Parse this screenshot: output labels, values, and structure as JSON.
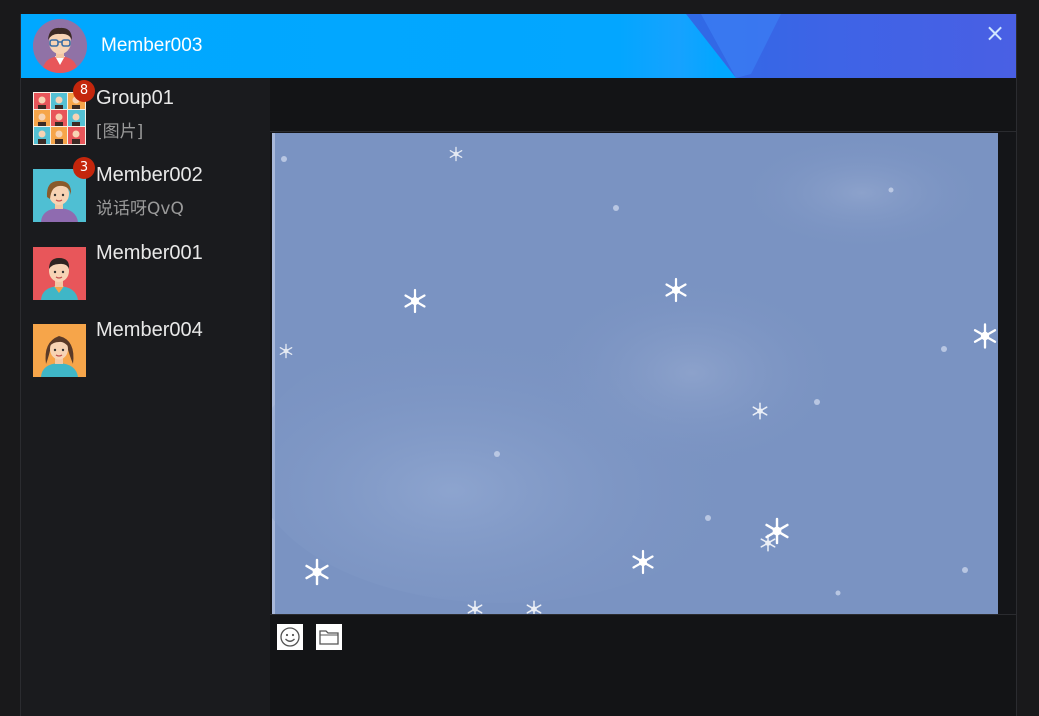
{
  "window": {
    "title_name": "Member003",
    "close_label": "×"
  },
  "contacts": [
    {
      "name": "Group01",
      "preview": "[图片]",
      "badge": "8",
      "avatar": "group-avatar"
    },
    {
      "name": "Member002",
      "preview": "说话呀QvQ",
      "badge": "3",
      "avatar": "female-avatar"
    },
    {
      "name": "Member001",
      "preview": "",
      "badge": "",
      "avatar": "male-avatar"
    },
    {
      "name": "Member004",
      "preview": "",
      "badge": "",
      "avatar": "female-avatar"
    }
  ],
  "toolbar": {
    "emoji_icon": "smiley-icon",
    "file_icon": "folder-icon"
  },
  "colors": {
    "titlebar_accent": "#00a8ff",
    "badge": "#c4260c",
    "snow_background": "#7a93c2"
  }
}
